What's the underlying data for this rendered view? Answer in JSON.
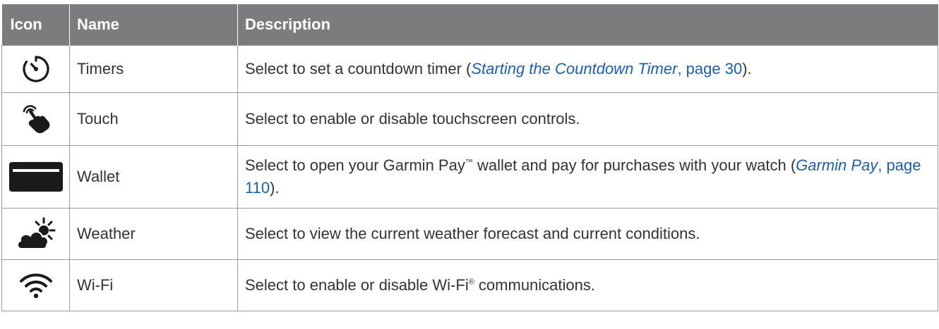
{
  "table": {
    "headers": {
      "icon": "Icon",
      "name": "Name",
      "description": "Description"
    },
    "rows": [
      {
        "icon": "timer-icon",
        "name": "Timers",
        "desc_before": "Select to set a countdown timer (",
        "link_title": "Starting the Countdown Timer",
        "link_page": ", page 30",
        "desc_after": ")."
      },
      {
        "icon": "touch-hand-icon",
        "name": "Touch",
        "desc_before": "Select to enable or disable touchscreen controls."
      },
      {
        "icon": "wallet-card-icon",
        "name": "Wallet",
        "desc_before": "Select to open your Garmin Pay",
        "desc_mark": "™",
        "desc_mid": " wallet and pay for purchases with your watch (",
        "link_title": "Garmin Pay",
        "link_page": ", page 110",
        "desc_after": ")."
      },
      {
        "icon": "weather-cloud-sun-icon",
        "name": "Weather",
        "desc_before": "Select to view the current weather forecast and current conditions."
      },
      {
        "icon": "wifi-icon",
        "name": "Wi-Fi",
        "desc_before": "Select to enable or disable Wi-Fi",
        "desc_mark": "®",
        "desc_mid": " communications."
      }
    ]
  },
  "colors": {
    "header_bg": "#7b7c7e",
    "header_text": "#ffffff",
    "link": "#1b5fb3",
    "icon": "#1a1a1a",
    "border": "#9a9a9a"
  }
}
